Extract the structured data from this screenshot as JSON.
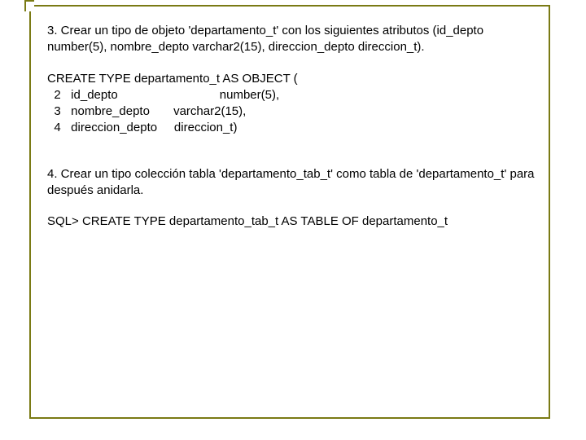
{
  "section3": {
    "text": "3. Crear un tipo de objeto 'departamento_t' con los siguientes atributos (id_depto number(5), nombre_depto varchar2(15), direccion_depto direccion_t)."
  },
  "code3": {
    "line1": "CREATE TYPE departamento_t AS OBJECT (",
    "line2": "  2   id_depto                              number(5),",
    "line3": "  3   nombre_depto       varchar2(15),",
    "line4": "  4   direccion_depto     direccion_t)"
  },
  "section4": {
    "text": "4. Crear un tipo colección tabla  'departamento_tab_t' como tabla de  'departamento_t' para después anidarla."
  },
  "code4": {
    "line1": "SQL> CREATE TYPE departamento_tab_t AS TABLE OF departamento_t"
  }
}
